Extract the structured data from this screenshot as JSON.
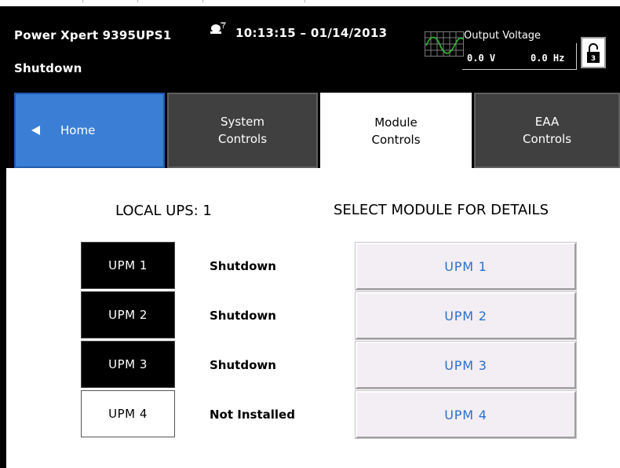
{
  "header": {
    "device_name": "Power Xpert 9395UPS1",
    "system_status": "Shutdown",
    "datetime": "10:13:15 – 01/14/2013",
    "output_voltage_label": "Output Voltage",
    "output_voltage_value": "0.0 V",
    "output_frequency_value": "0.0 Hz",
    "lock_level": "3",
    "alarm_icon": "alarm-silence-icon",
    "lock_icon": "unlocked-padlock-icon"
  },
  "nav": {
    "home_label": "Home",
    "system_controls_label": "System\nControls",
    "module_controls_label": "Module\nControls",
    "eaa_controls_label": "EAA\nControls",
    "active_tab": "Module Controls"
  },
  "main": {
    "local_ups_heading": "LOCAL UPS: 1",
    "select_heading": "SELECT MODULE FOR DETAILS",
    "modules": [
      {
        "name": "UPM 1",
        "status": "Shutdown",
        "button_label": "UPM 1"
      },
      {
        "name": "UPM 2",
        "status": "Shutdown",
        "button_label": "UPM 2"
      },
      {
        "name": "UPM 3",
        "status": "Shutdown",
        "button_label": "UPM 3"
      },
      {
        "name": "UPM 4",
        "status": "Not Installed",
        "button_label": "UPM 4"
      }
    ]
  },
  "colors": {
    "header_bg": "#000000",
    "home_tab": "#3a7fd5",
    "inactive_tab": "#404040",
    "module_button_text": "#2a6fce",
    "module_button_bg": "#f3eef3"
  }
}
